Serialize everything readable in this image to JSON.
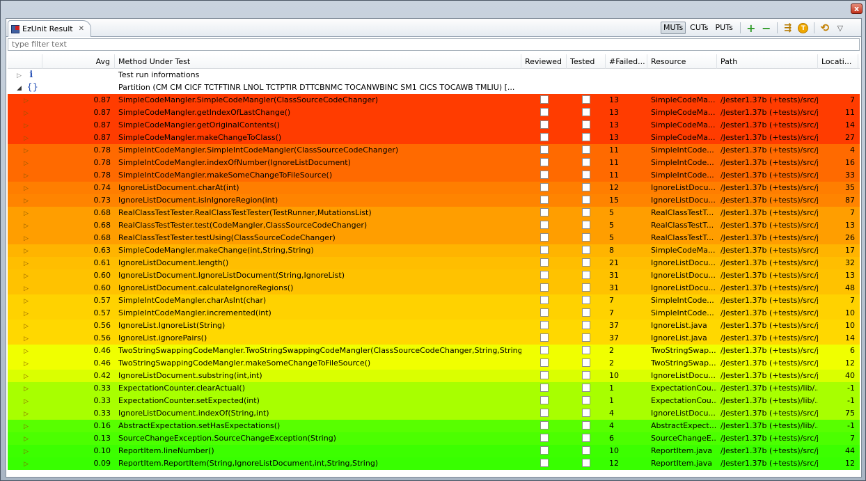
{
  "window": {
    "close_glyph": "x"
  },
  "tab": {
    "label": "EzUnit Result",
    "icon": "ezunit-icon",
    "close_glyph": "✕"
  },
  "toolbar": {
    "muts": "MUTs",
    "cuts": "CUTs",
    "puts": "PUTs",
    "add": "+",
    "remove": "−",
    "t": "T",
    "filter_glyph": "⇶",
    "sync_glyph": "⟲",
    "menu_glyph": "▽"
  },
  "filter": {
    "placeholder": "type filter text"
  },
  "columns": {
    "avg": "Avg",
    "method": "Method Under Test",
    "reviewed": "Reviewed",
    "tested": "Tested",
    "failed": "#Failed...",
    "resource": "Resource",
    "path": "Path",
    "location": "Locati..."
  },
  "top_rows": [
    {
      "icon": "i",
      "text": "Test run informations",
      "expander": "▷"
    },
    {
      "icon": "{}",
      "text": "Partition (CM CM CICF TCTFTINR LNOL TCTPTIR DTTCBNMC TOCANWBINC SM1 CICS TOCAWB TMLIU) [...",
      "expander": "◢"
    }
  ],
  "rows": [
    {
      "avg": "0.87",
      "method": "SimpleCodeMangler.SimpleCodeMangler(ClassSourceCodeChanger)",
      "failed": "13",
      "resource": "SimpleCodeMa...",
      "path": "/Jester1.37b (+tests)/src/j...",
      "loc": "7",
      "color": "#ff3c00"
    },
    {
      "avg": "0.87",
      "method": "SimpleCodeMangler.getIndexOfLastChange()",
      "failed": "13",
      "resource": "SimpleCodeMa...",
      "path": "/Jester1.37b (+tests)/src/j...",
      "loc": "11",
      "color": "#ff3c00"
    },
    {
      "avg": "0.87",
      "method": "SimpleCodeMangler.getOriginalContents()",
      "failed": "13",
      "resource": "SimpleCodeMa...",
      "path": "/Jester1.37b (+tests)/src/j...",
      "loc": "14",
      "color": "#ff3c00"
    },
    {
      "avg": "0.87",
      "method": "SimpleCodeMangler.makeChangeToClass()",
      "failed": "13",
      "resource": "SimpleCodeMa...",
      "path": "/Jester1.37b (+tests)/src/j...",
      "loc": "27",
      "color": "#ff3c00"
    },
    {
      "avg": "0.78",
      "method": "SimpleIntCodeMangler.SimpleIntCodeMangler(ClassSourceCodeChanger)",
      "failed": "11",
      "resource": "SimpleIntCode...",
      "path": "/Jester1.37b (+tests)/src/j...",
      "loc": "4",
      "color": "#ff6a00"
    },
    {
      "avg": "0.78",
      "method": "SimpleIntCodeMangler.indexOfNumber(IgnoreListDocument)",
      "failed": "11",
      "resource": "SimpleIntCode...",
      "path": "/Jester1.37b (+tests)/src/j...",
      "loc": "16",
      "color": "#ff6a00"
    },
    {
      "avg": "0.78",
      "method": "SimpleIntCodeMangler.makeSomeChangeToFileSource()",
      "failed": "11",
      "resource": "SimpleIntCode...",
      "path": "/Jester1.37b (+tests)/src/j...",
      "loc": "33",
      "color": "#ff6a00"
    },
    {
      "avg": "0.74",
      "method": "IgnoreListDocument.charAt(int)",
      "failed": "12",
      "resource": "IgnoreListDocu...",
      "path": "/Jester1.37b (+tests)/src/j...",
      "loc": "35",
      "color": "#ff7e00"
    },
    {
      "avg": "0.73",
      "method": "IgnoreListDocument.isInIgnoreRegion(int)",
      "failed": "15",
      "resource": "IgnoreListDocu...",
      "path": "/Jester1.37b (+tests)/src/j...",
      "loc": "87",
      "color": "#ff8400"
    },
    {
      "avg": "0.68",
      "method": "RealClassTestTester.RealClassTestTester(TestRunner,MutationsList)",
      "failed": "5",
      "resource": "RealClassTestT...",
      "path": "/Jester1.37b (+tests)/src/j...",
      "loc": "7",
      "color": "#ff9e00"
    },
    {
      "avg": "0.68",
      "method": "RealClassTestTester.test(CodeMangler,ClassSourceCodeChanger)",
      "failed": "5",
      "resource": "RealClassTestT...",
      "path": "/Jester1.37b (+tests)/src/j...",
      "loc": "13",
      "color": "#ff9e00"
    },
    {
      "avg": "0.68",
      "method": "RealClassTestTester.testUsing(ClassSourceCodeChanger)",
      "failed": "5",
      "resource": "RealClassTestT...",
      "path": "/Jester1.37b (+tests)/src/j...",
      "loc": "26",
      "color": "#ff9e00"
    },
    {
      "avg": "0.63",
      "method": "SimpleCodeMangler.makeChange(int,String,String)",
      "failed": "8",
      "resource": "SimpleCodeMa...",
      "path": "/Jester1.37b (+tests)/src/j...",
      "loc": "17",
      "color": "#ffb400"
    },
    {
      "avg": "0.61",
      "method": "IgnoreListDocument.length()",
      "failed": "21",
      "resource": "IgnoreListDocu...",
      "path": "/Jester1.37b (+tests)/src/j...",
      "loc": "32",
      "color": "#ffbe00"
    },
    {
      "avg": "0.60",
      "method": "IgnoreListDocument.IgnoreListDocument(String,IgnoreList)",
      "failed": "31",
      "resource": "IgnoreListDocu...",
      "path": "/Jester1.37b (+tests)/src/j...",
      "loc": "13",
      "color": "#ffc200"
    },
    {
      "avg": "0.60",
      "method": "IgnoreListDocument.calculateIgnoreRegions()",
      "failed": "31",
      "resource": "IgnoreListDocu...",
      "path": "/Jester1.37b (+tests)/src/j...",
      "loc": "48",
      "color": "#ffc200"
    },
    {
      "avg": "0.57",
      "method": "SimpleIntCodeMangler.charAsInt(char)",
      "failed": "7",
      "resource": "SimpleIntCode...",
      "path": "/Jester1.37b (+tests)/src/j...",
      "loc": "7",
      "color": "#ffd200"
    },
    {
      "avg": "0.57",
      "method": "SimpleIntCodeMangler.incremented(int)",
      "failed": "7",
      "resource": "SimpleIntCode...",
      "path": "/Jester1.37b (+tests)/src/j...",
      "loc": "10",
      "color": "#ffd200"
    },
    {
      "avg": "0.56",
      "method": "IgnoreList.IgnoreList(String)",
      "failed": "37",
      "resource": "IgnoreList.java",
      "path": "/Jester1.37b (+tests)/src/j...",
      "loc": "10",
      "color": "#ffd800"
    },
    {
      "avg": "0.56",
      "method": "IgnoreList.ignorePairs()",
      "failed": "37",
      "resource": "IgnoreList.java",
      "path": "/Jester1.37b (+tests)/src/j...",
      "loc": "14",
      "color": "#ffd800"
    },
    {
      "avg": "0.46",
      "method": "TwoStringSwappingCodeMangler.TwoStringSwappingCodeMangler(ClassSourceCodeChanger,String,String)",
      "failed": "2",
      "resource": "TwoStringSwap...",
      "path": "/Jester1.37b (+tests)/src/j...",
      "loc": "6",
      "color": "#f0ff00"
    },
    {
      "avg": "0.46",
      "method": "TwoStringSwappingCodeMangler.makeSomeChangeToFileSource()",
      "failed": "2",
      "resource": "TwoStringSwap...",
      "path": "/Jester1.37b (+tests)/src/j...",
      "loc": "12",
      "color": "#f0ff00"
    },
    {
      "avg": "0.42",
      "method": "IgnoreListDocument.substring(int,int)",
      "failed": "10",
      "resource": "IgnoreListDocu...",
      "path": "/Jester1.37b (+tests)/src/j...",
      "loc": "40",
      "color": "#daff00"
    },
    {
      "avg": "0.33",
      "method": "ExpectationCounter.clearActual()",
      "failed": "1",
      "resource": "ExpectationCou...",
      "path": "/Jester1.37b (+tests)/lib/...",
      "loc": "-1",
      "color": "#a8ff00"
    },
    {
      "avg": "0.33",
      "method": "ExpectationCounter.setExpected(int)",
      "failed": "1",
      "resource": "ExpectationCou...",
      "path": "/Jester1.37b (+tests)/lib/...",
      "loc": "-1",
      "color": "#a8ff00"
    },
    {
      "avg": "0.33",
      "method": "IgnoreListDocument.indexOf(String,int)",
      "failed": "4",
      "resource": "IgnoreListDocu...",
      "path": "/Jester1.37b (+tests)/src/j...",
      "loc": "75",
      "color": "#a8ff00"
    },
    {
      "avg": "0.16",
      "method": "AbstractExpectation.setHasExpectations()",
      "failed": "4",
      "resource": "AbstractExpect...",
      "path": "/Jester1.37b (+tests)/lib/...",
      "loc": "-1",
      "color": "#58ff00"
    },
    {
      "avg": "0.13",
      "method": "SourceChangeException.SourceChangeException(String)",
      "failed": "6",
      "resource": "SourceChangeE...",
      "path": "/Jester1.37b (+tests)/src/j...",
      "loc": "7",
      "color": "#4cff00"
    },
    {
      "avg": "0.10",
      "method": "ReportItem.lineNumber()",
      "failed": "10",
      "resource": "ReportItem.java",
      "path": "/Jester1.37b (+tests)/src/j...",
      "loc": "44",
      "color": "#3cff00"
    },
    {
      "avg": "0.09",
      "method": "ReportItem.ReportItem(String,IgnoreListDocument,int,String,String)",
      "failed": "12",
      "resource": "ReportItem.java",
      "path": "/Jester1.37b (+tests)/src/j...",
      "loc": "12",
      "color": "#38ff00"
    }
  ]
}
